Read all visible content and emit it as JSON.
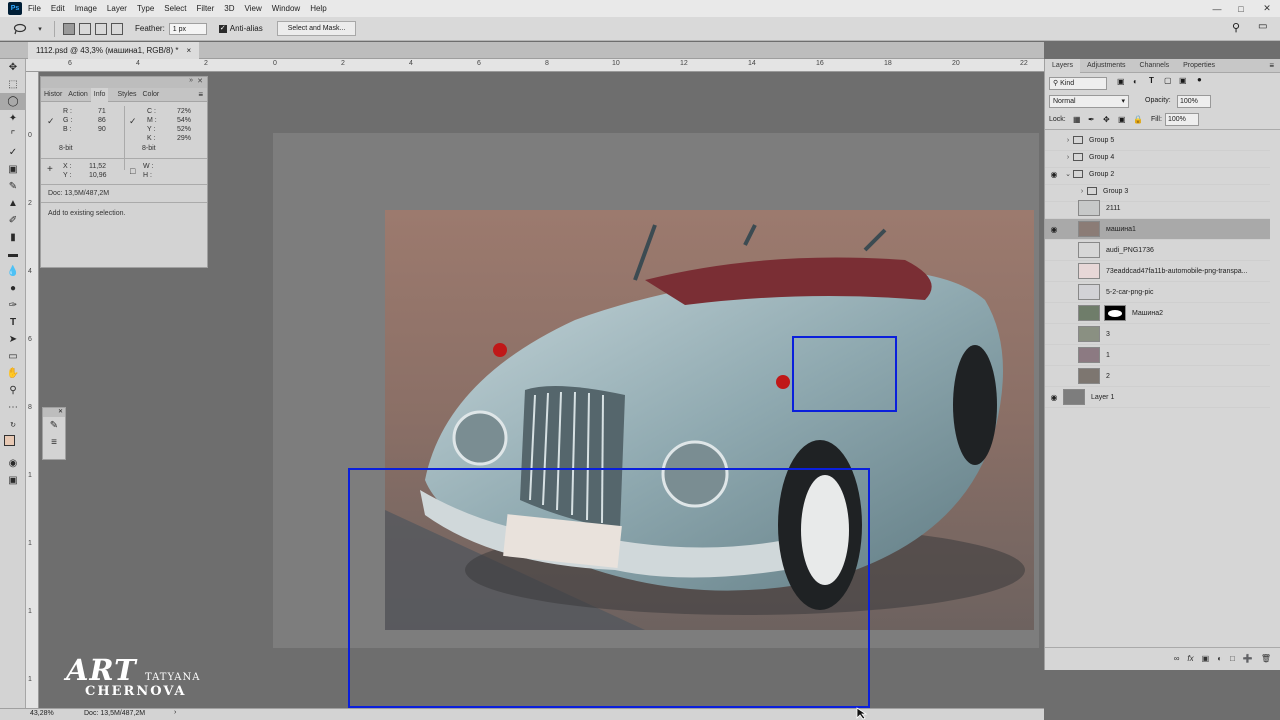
{
  "menubar": {
    "logo": "Ps",
    "items": [
      "File",
      "Edit",
      "Image",
      "Layer",
      "Type",
      "Select",
      "Filter",
      "3D",
      "View",
      "Window",
      "Help"
    ]
  },
  "options": {
    "feather_label": "Feather:",
    "feather_value": "1 px",
    "antialias_label": "Anti-alias",
    "select_mask_label": "Select and Mask..."
  },
  "document_tab": {
    "title": "1112.psd @ 43,3% (машина1, RGB/8) *",
    "close": "×"
  },
  "ruler": {
    "h_ticks": [
      "6",
      "4",
      "2",
      "0",
      "2",
      "4",
      "6",
      "8",
      "10",
      "12",
      "14",
      "16",
      "18",
      "20",
      "22"
    ],
    "v_ticks": [
      "0",
      "2",
      "4",
      "6",
      "8",
      "1",
      "1",
      "1",
      "1",
      "1",
      "1"
    ]
  },
  "info_panel": {
    "tabs": [
      "Histor",
      "Action",
      "Info",
      "Styles",
      "Color"
    ],
    "active_tab": "Info",
    "rgb": {
      "R": "71",
      "G": "86",
      "B": "90"
    },
    "cmyk": {
      "C": "72%",
      "M": "54%",
      "Y": "52%",
      "K": "29%"
    },
    "bit_left": "8-bit",
    "bit_right": "8-bit",
    "x": "11,52",
    "y": "10,96",
    "w": "",
    "h": "",
    "doc": "Doc: 13,5M/487,2M",
    "hint": "Add to existing selection."
  },
  "layers_panel": {
    "tabs": [
      "Layers",
      "Adjustments",
      "Channels",
      "Properties"
    ],
    "active_tab": "Layers",
    "filter": "Kind",
    "blend_mode": "Normal",
    "opacity_label": "Opacity:",
    "opacity_value": "100%",
    "lock_label": "Lock:",
    "fill_label": "Fill:",
    "fill_value": "100%",
    "layers": [
      {
        "name": "Group 5",
        "kind": "group",
        "visible": false,
        "indent": 0,
        "expanded": false
      },
      {
        "name": "Group 4",
        "kind": "group",
        "visible": false,
        "indent": 0,
        "expanded": false
      },
      {
        "name": "Group 2",
        "kind": "group",
        "visible": true,
        "indent": 0,
        "expanded": true
      },
      {
        "name": "Group 3",
        "kind": "group",
        "visible": false,
        "indent": 1,
        "expanded": false
      },
      {
        "name": "2111",
        "kind": "smart",
        "visible": false,
        "indent": 1
      },
      {
        "name": "машина1",
        "kind": "smart",
        "visible": true,
        "indent": 1,
        "selected": true
      },
      {
        "name": "audi_PNG1736",
        "kind": "smart",
        "visible": false,
        "indent": 1
      },
      {
        "name": "73eaddcad47fa11b-automobile-png-transpa...",
        "kind": "smart",
        "visible": false,
        "indent": 1
      },
      {
        "name": "5-2-car-png-pic",
        "kind": "smart",
        "visible": false,
        "indent": 1
      },
      {
        "name": "Машина2",
        "kind": "masked",
        "visible": false,
        "indent": 1
      },
      {
        "name": "3",
        "kind": "smart",
        "visible": false,
        "indent": 1
      },
      {
        "name": "1",
        "kind": "smart",
        "visible": false,
        "indent": 1
      },
      {
        "name": "2",
        "kind": "smart",
        "visible": false,
        "indent": 1
      },
      {
        "name": "Layer 1",
        "kind": "fill",
        "visible": true,
        "indent": 0
      }
    ]
  },
  "statusbar": {
    "zoom": "43,28%",
    "doc": "Doc: 13,5M/487,2M"
  },
  "watermark": {
    "art": "ART",
    "tatyana": "TATYANA",
    "chernova": "CHERNOVA"
  },
  "colors": {
    "annotation": "#0a1fdc",
    "foreground_swatch": "#e8c9b4",
    "background_swatch": "#3a1a12"
  }
}
